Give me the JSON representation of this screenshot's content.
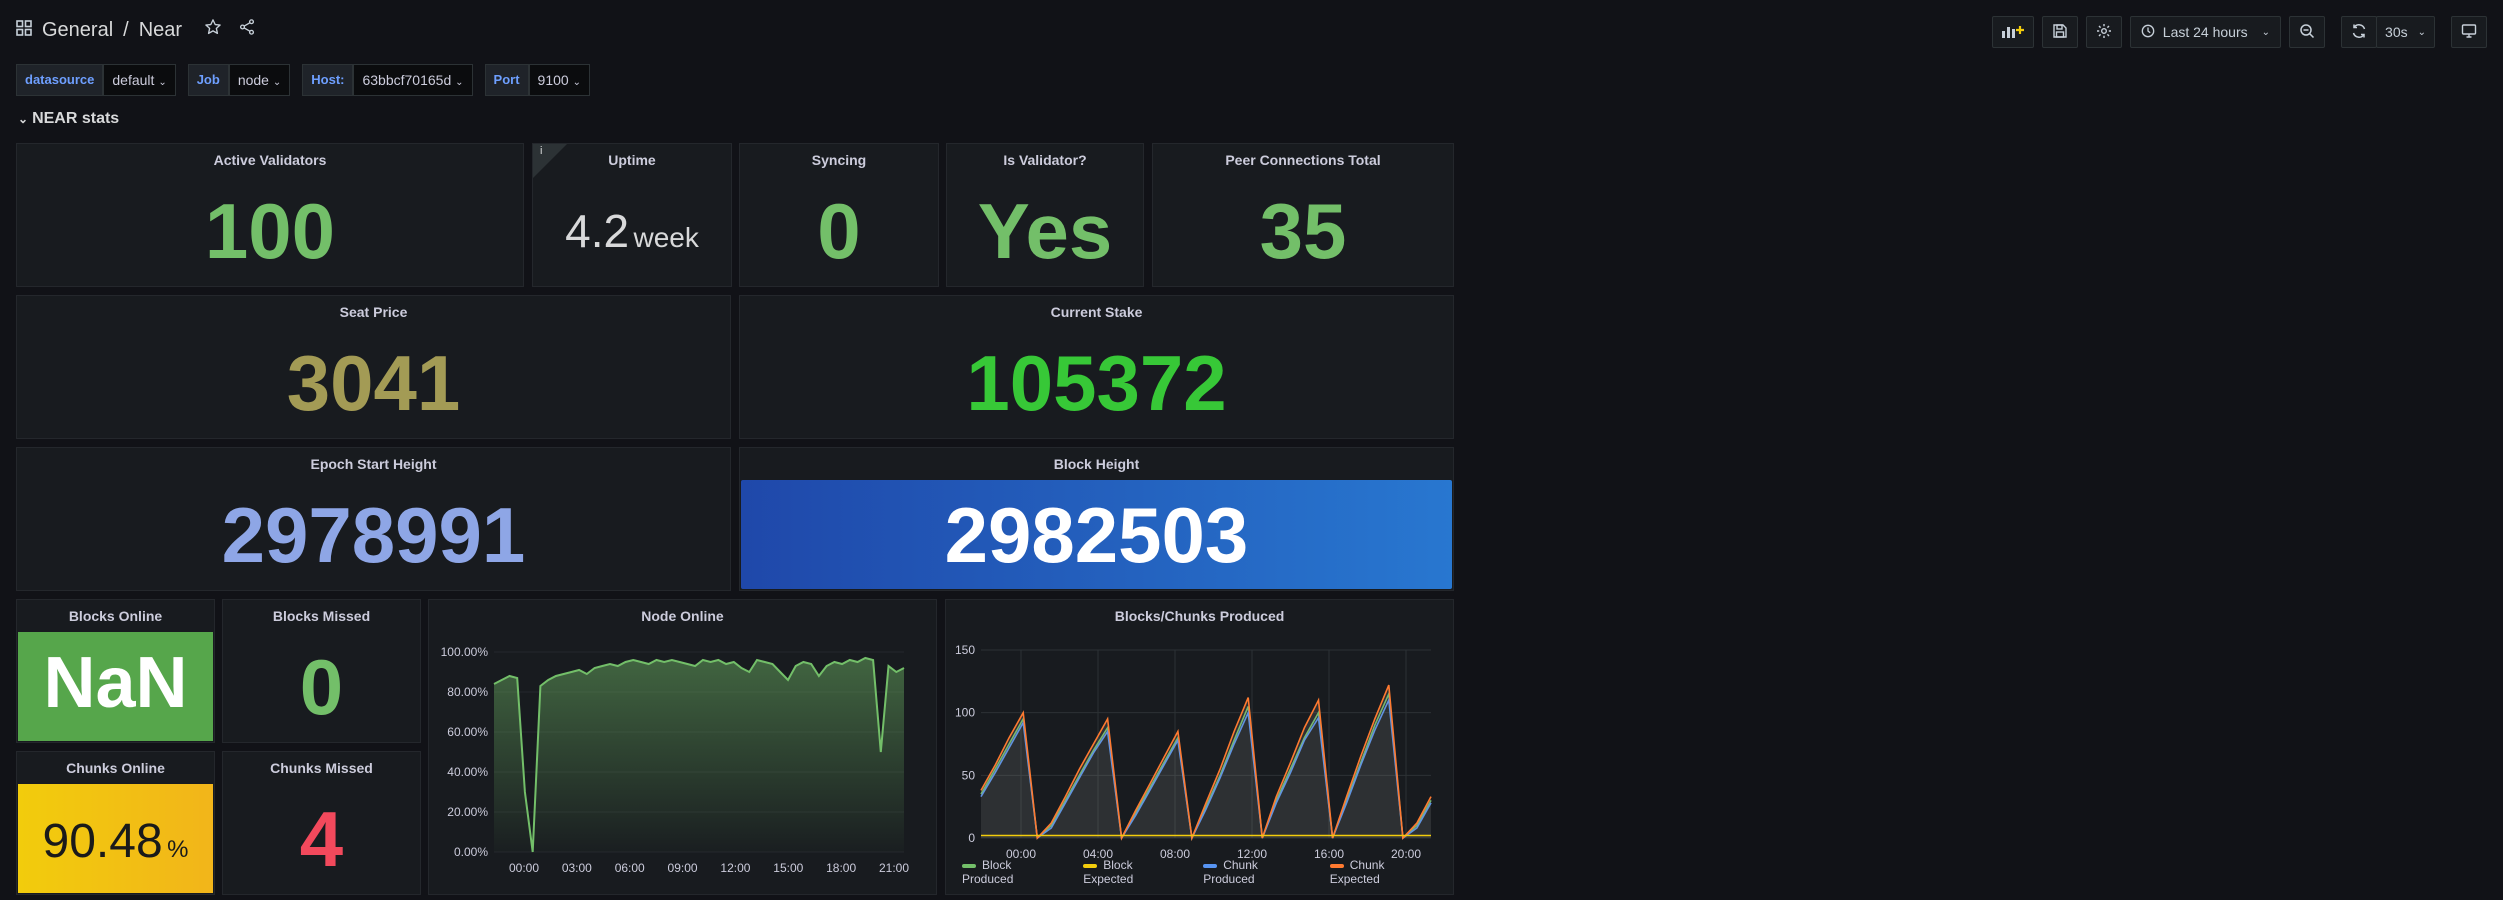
{
  "breadcrumb": {
    "folder": "General",
    "separator": "/",
    "dashboard": "Near"
  },
  "toolbar": {
    "time_range": "Last 24 hours",
    "refresh": "30s"
  },
  "variables": [
    {
      "label": "datasource",
      "value": "default"
    },
    {
      "label": "Job",
      "value": "node"
    },
    {
      "label": "Host:",
      "value": "63bbcf70165d"
    },
    {
      "label": "Port",
      "value": "9100"
    }
  ],
  "row": {
    "title": "NEAR stats"
  },
  "panels": {
    "active_validators": {
      "title": "Active Validators",
      "value": "100"
    },
    "uptime": {
      "title": "Uptime",
      "value": "4.2",
      "unit": "week",
      "info": "i"
    },
    "syncing": {
      "title": "Syncing",
      "value": "0"
    },
    "is_validator": {
      "title": "Is Validator?",
      "value": "Yes"
    },
    "peer_connections": {
      "title": "Peer Connections Total",
      "value": "35"
    },
    "seat_price": {
      "title": "Seat Price",
      "value": "3041"
    },
    "current_stake": {
      "title": "Current Stake",
      "value": "105372"
    },
    "epoch_start": {
      "title": "Epoch Start Height",
      "value": "2978991"
    },
    "block_height": {
      "title": "Block Height",
      "value": "2982503"
    },
    "blocks_online": {
      "title": "Blocks Online",
      "value": "NaN"
    },
    "blocks_missed": {
      "title": "Blocks Missed",
      "value": "0"
    },
    "chunks_online": {
      "title": "Chunks Online",
      "value": "90.48",
      "unit": "%"
    },
    "chunks_missed": {
      "title": "Chunks Missed",
      "value": "4"
    },
    "node_online": {
      "title": "Node Online"
    },
    "blocks_chunks": {
      "title": "Blocks/Chunks Produced"
    }
  },
  "colors": {
    "green": "#73bf69",
    "olive": "#a39b55",
    "bright_green": "#37c837",
    "lavender": "#8ea6e6",
    "red": "#f2495c",
    "yellow": "#f2cc0c",
    "blue": "#1f60c4",
    "orange": "#ff7a30"
  },
  "chart_data": [
    {
      "type": "area",
      "title": "Node Online",
      "x_ticks": [
        "00:00",
        "03:00",
        "06:00",
        "09:00",
        "12:00",
        "15:00",
        "18:00",
        "21:00"
      ],
      "y_ticks": [
        "0.00%",
        "20.00%",
        "40.00%",
        "60.00%",
        "80.00%",
        "100.00%"
      ],
      "ylim": [
        0,
        100
      ],
      "series": [
        {
          "values": [
            84,
            86,
            88,
            87,
            30,
            0,
            83,
            86,
            88,
            89,
            90,
            91,
            89,
            92,
            93,
            94,
            93,
            95,
            96,
            95,
            94,
            96,
            95,
            96,
            95,
            94,
            93,
            96,
            95,
            96,
            94,
            95,
            92,
            90,
            96,
            95,
            94,
            90,
            86,
            93,
            95,
            94,
            88,
            93,
            95,
            94,
            96,
            95,
            97,
            96,
            50,
            93,
            90,
            92
          ]
        }
      ]
    },
    {
      "type": "line",
      "title": "Blocks/Chunks Produced",
      "x_ticks": [
        "00:00",
        "04:00",
        "08:00",
        "12:00",
        "16:00",
        "20:00"
      ],
      "y_ticks": [
        "0",
        "50",
        "100",
        "150"
      ],
      "ylim": [
        0,
        150
      ],
      "series": [
        {
          "name": "Block Produced",
          "color": "#73bf69",
          "values": [
            35,
            55,
            75,
            95,
            0,
            10,
            30,
            50,
            70,
            88,
            0,
            20,
            40,
            60,
            80,
            0,
            25,
            50,
            78,
            105,
            0,
            30,
            55,
            80,
            100,
            0,
            30,
            60,
            90,
            115,
            0,
            10,
            30
          ]
        },
        {
          "name": "Block Expected",
          "color": "#f2cc0c",
          "values": [
            2,
            2,
            2,
            2,
            2,
            2,
            2,
            2,
            2,
            2,
            2,
            2,
            2,
            2,
            2,
            2,
            2,
            2,
            2,
            2,
            2,
            2,
            2,
            2,
            2,
            2,
            2,
            2,
            2,
            2,
            2,
            2,
            2
          ]
        },
        {
          "name": "Chunk Produced",
          "color": "#5794f2",
          "values": [
            33,
            52,
            72,
            92,
            0,
            8,
            28,
            48,
            68,
            85,
            0,
            18,
            38,
            58,
            78,
            0,
            23,
            48,
            75,
            100,
            0,
            28,
            52,
            78,
            96,
            0,
            28,
            58,
            86,
            110,
            0,
            8,
            28
          ]
        },
        {
          "name": "Chunk Expected",
          "color": "#ff7a30",
          "values": [
            38,
            58,
            80,
            100,
            0,
            12,
            33,
            55,
            75,
            95,
            0,
            22,
            43,
            64,
            85,
            0,
            28,
            55,
            85,
            112,
            0,
            33,
            60,
            88,
            110,
            0,
            33,
            65,
            95,
            122,
            0,
            12,
            33
          ]
        }
      ]
    }
  ]
}
